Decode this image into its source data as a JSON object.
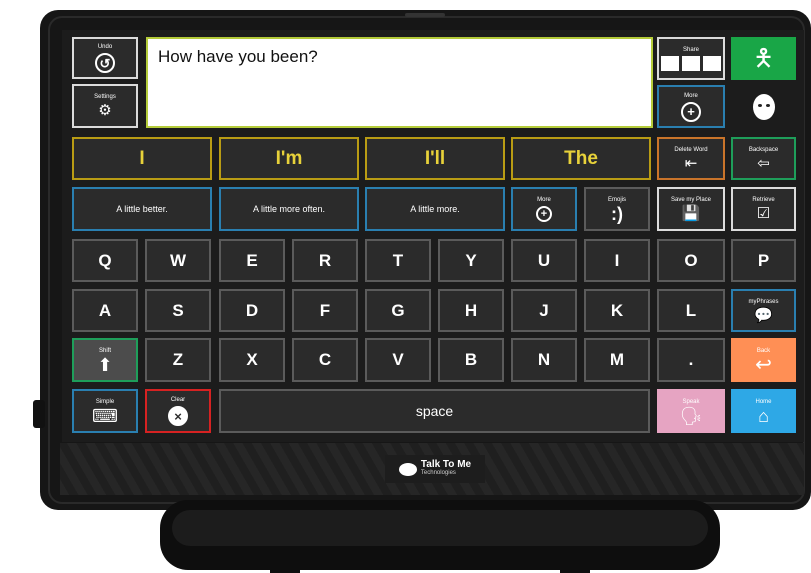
{
  "message": "How have you been?",
  "brand": {
    "name": "Talk To Me",
    "sub": "Technologies"
  },
  "top_left": {
    "undo_label": "Undo",
    "settings_label": "Settings"
  },
  "top_right": {
    "share_label": "Share",
    "more_label": "More"
  },
  "word_predictions": [
    "I",
    "I'm",
    "I'll",
    "The"
  ],
  "phrases": [
    "A little better.",
    "A little more often.",
    "A little more."
  ],
  "side": {
    "delete_word": "Delete Word",
    "backspace": "Backspace",
    "more": "More",
    "emojis": "Emojis",
    "emoji_glyph": ":)",
    "save_my_place": "Save my Place",
    "retrieve": "Retrieve",
    "myphrases": "myPhrases",
    "back": "Back",
    "shift": "Shift",
    "simple": "Simple",
    "clear": "Clear",
    "speak": "Speak",
    "home": "Home"
  },
  "keys": {
    "row1": [
      "Q",
      "W",
      "E",
      "R",
      "T",
      "Y",
      "U",
      "I",
      "O",
      "P"
    ],
    "row2": [
      "A",
      "S",
      "D",
      "F",
      "G",
      "H",
      "J",
      "K",
      "L"
    ],
    "row3": [
      "Z",
      "X",
      "C",
      "V",
      "B",
      "N",
      "M",
      "."
    ],
    "space": "space"
  },
  "colors": {
    "prediction_border": "#b99c14",
    "prediction_text": "#e8d23a",
    "phrase_border": "#2a7fb0",
    "speak": "#e6a4c2",
    "back": "#ff8f55",
    "home": "#2ea8e6",
    "person": "#19a647",
    "clear_border": "#d62222",
    "message_border": "#b5cc3a"
  }
}
